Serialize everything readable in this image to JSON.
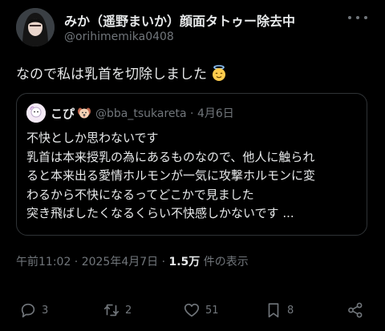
{
  "author": {
    "display_name": "みか（遥野まいか）顔面タトゥー除去中",
    "handle": "@orihimemika0408"
  },
  "tweet": {
    "text": "なので私は乳首を切除しました",
    "emoji_icon": "angel-face-icon"
  },
  "quote": {
    "name": "こぴ",
    "name_emoji_icon": "dog-face-icon",
    "handle_date": "@bba_tsukareta · 4月6日",
    "lines": [
      "不快としか思わないです",
      "乳首は本来授乳の為にあるものなので、他人に触られ",
      "ると本来出る愛情ホルモンが一気に攻撃ホルモンに変",
      "わるから不快になるってどこかで見ました",
      "突き飛ばしたくなるくらい不快感しかないです ..."
    ]
  },
  "meta": {
    "timestamp": "午前11:02 · 2025年4月7日 · ",
    "views_count": "1.5万",
    "views_label": " 件の表示"
  },
  "actions": {
    "reply_count": "3",
    "retweet_count": "2",
    "like_count": "51",
    "bookmark_count": "8"
  },
  "colors": {
    "background": "#000000",
    "text": "#e7e9ea",
    "secondary": "#71767b",
    "border": "#2f3336"
  }
}
